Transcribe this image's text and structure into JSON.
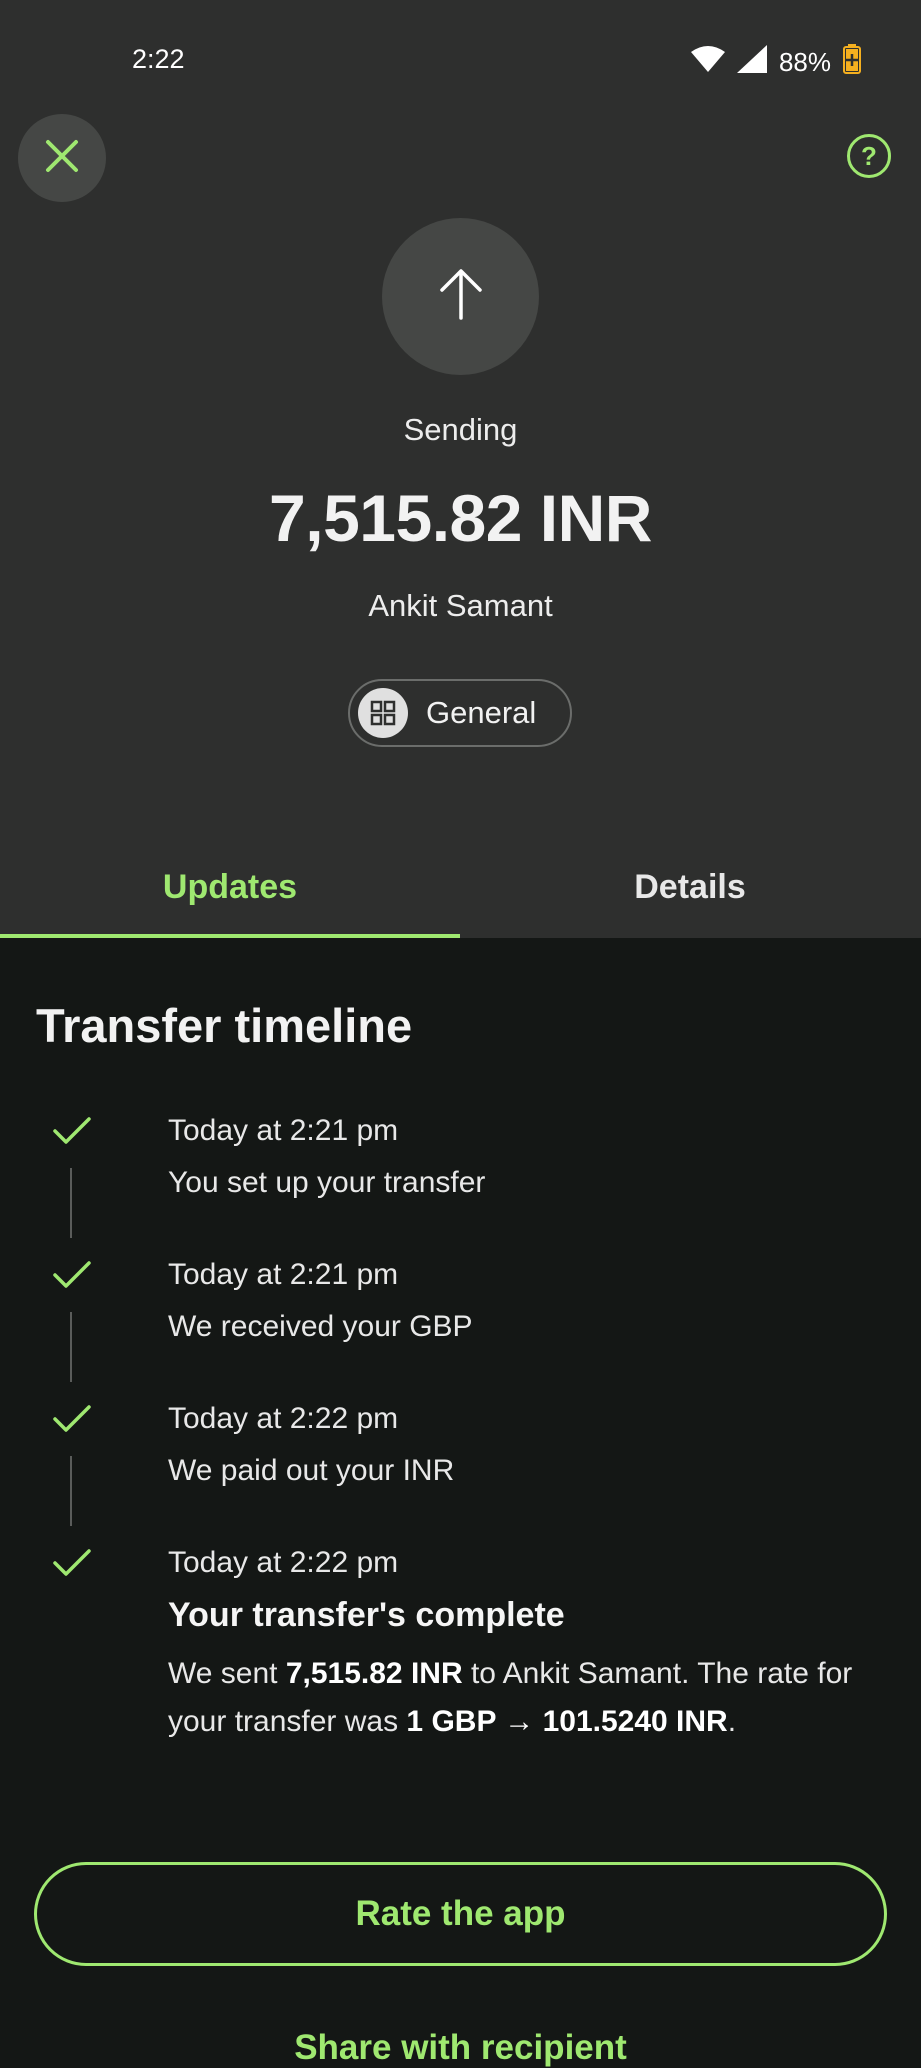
{
  "status_bar": {
    "time": "2:22",
    "battery": "88%"
  },
  "header": {
    "status_label": "Sending",
    "amount": "7,515.82 INR",
    "recipient": "Ankit Samant",
    "category": "General"
  },
  "tabs": [
    {
      "label": "Updates",
      "active": true
    },
    {
      "label": "Details",
      "active": false
    }
  ],
  "timeline": {
    "title": "Transfer timeline",
    "items": [
      {
        "time": "Today at 2:21 pm",
        "text": "You set up your transfer"
      },
      {
        "time": "Today at 2:21 pm",
        "text": "We received your GBP"
      },
      {
        "time": "Today at 2:22 pm",
        "text": "We paid out your INR"
      },
      {
        "time": "Today at 2:22 pm",
        "heading": "Your transfer's complete",
        "desc_prefix": "We sent ",
        "desc_amount": "7,515.82 INR",
        "desc_mid": " to Ankit Samant. The rate for your transfer was ",
        "desc_rate": "1 GBP → 101.5240 INR",
        "desc_suffix": "."
      }
    ]
  },
  "actions": {
    "rate_label": "Rate the app",
    "share_label": "Share with recipient"
  },
  "colors": {
    "accent": "#9fe870",
    "header_bg": "#2e2f2e",
    "body_bg": "#141715"
  },
  "icons": {
    "close": "close-icon",
    "help": "help-icon",
    "arrow": "arrow-up-icon",
    "category": "grid-icon",
    "check": "check-icon"
  }
}
